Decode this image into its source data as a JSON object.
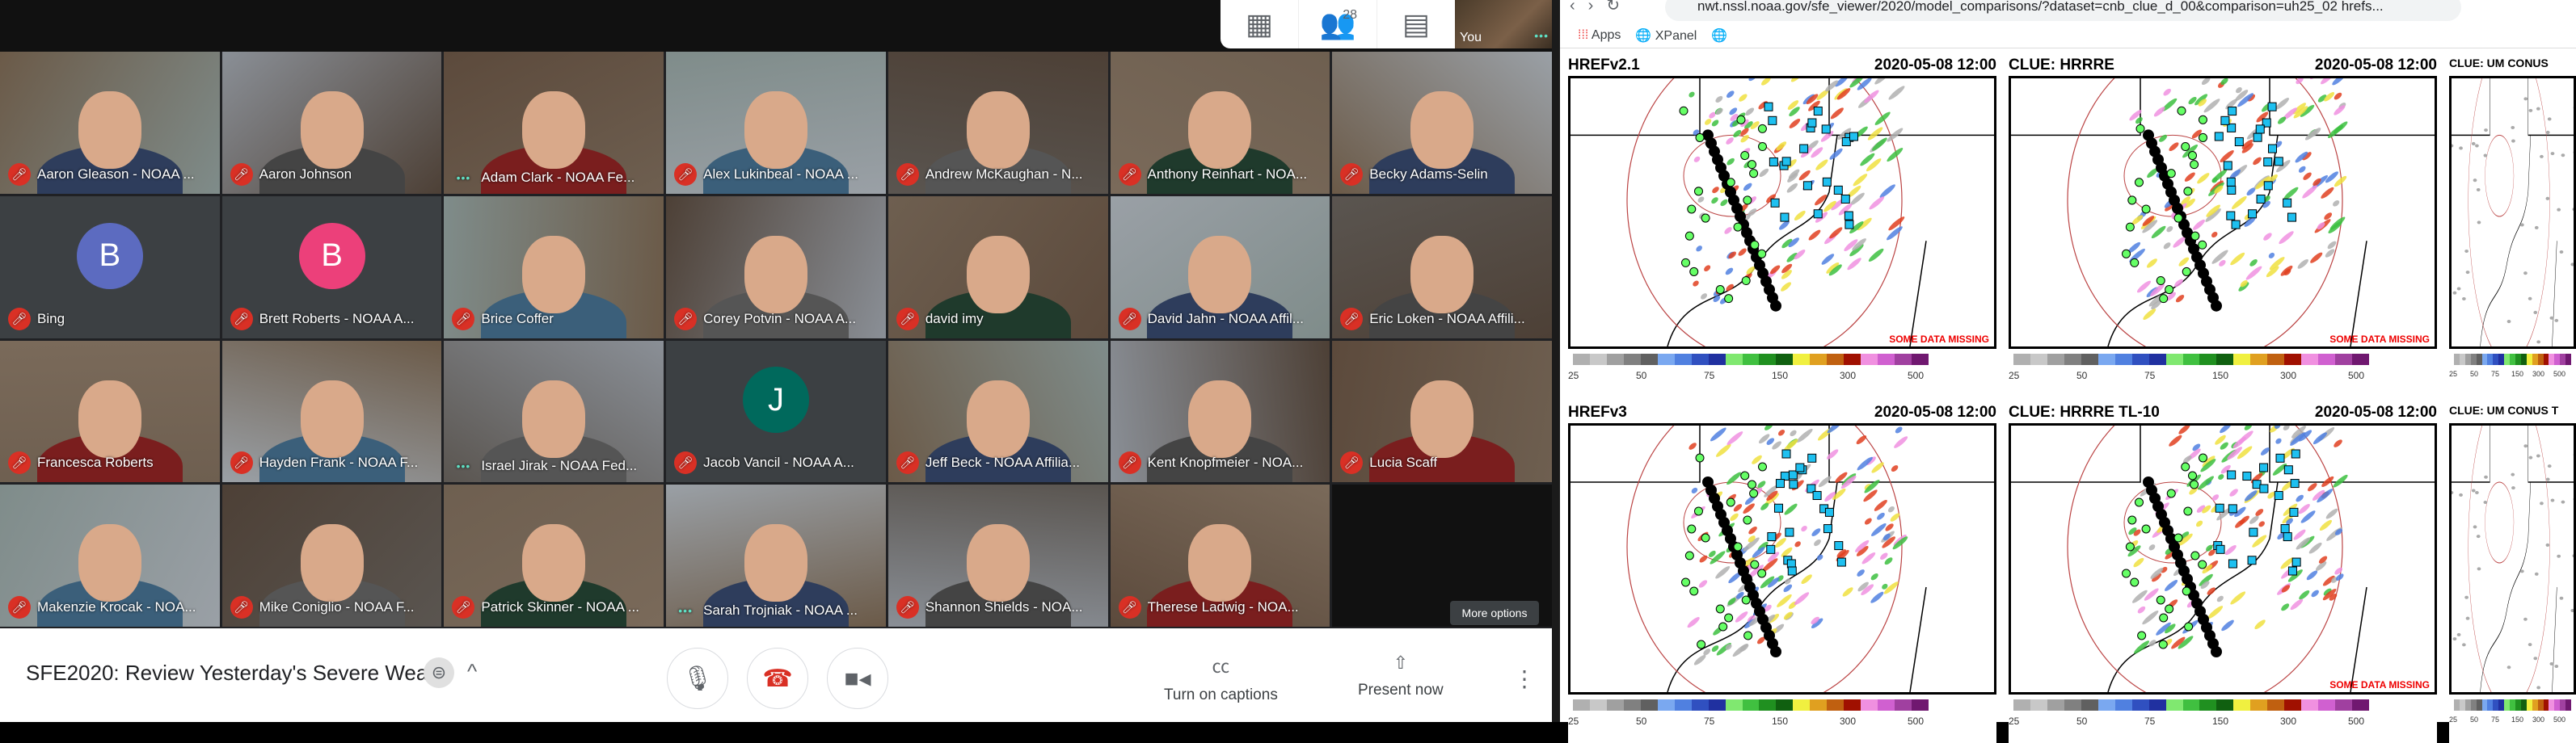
{
  "meet": {
    "controls": {
      "grid_icon": "grid-view-icon",
      "people_count": "28",
      "chat_icon": "chat-icon"
    },
    "self_view": {
      "label": "You"
    },
    "participants": [
      {
        "name": "Aaron Gleason - NOAA ...",
        "state": "muted"
      },
      {
        "name": "Aaron Johnson",
        "state": "muted"
      },
      {
        "name": "Adam Clark - NOAA Fe...",
        "state": "talking"
      },
      {
        "name": "Alex Lukinbeal - NOAA ...",
        "state": "muted"
      },
      {
        "name": "Andrew McKaughan - N...",
        "state": "muted"
      },
      {
        "name": "Anthony Reinhart - NOA...",
        "state": "muted"
      },
      {
        "name": "Becky Adams-Selin",
        "state": "muted"
      },
      {
        "name": "Bing",
        "state": "muted",
        "avatar": "B",
        "avatar_color": "#5c6bc0"
      },
      {
        "name": "Brett Roberts - NOAA A...",
        "state": "muted",
        "avatar": "B",
        "avatar_color": "#ec407a"
      },
      {
        "name": "Brice Coffer",
        "state": "muted"
      },
      {
        "name": "Corey Potvin - NOAA A...",
        "state": "muted"
      },
      {
        "name": "david imy",
        "state": "muted"
      },
      {
        "name": "David Jahn - NOAA Affil...",
        "state": "muted"
      },
      {
        "name": "Eric Loken - NOAA Affili...",
        "state": "muted"
      },
      {
        "name": "Francesca Roberts",
        "state": "muted"
      },
      {
        "name": "Hayden Frank - NOAA F...",
        "state": "muted"
      },
      {
        "name": "Israel Jirak - NOAA Fed...",
        "state": "talking"
      },
      {
        "name": "Jacob Vancil - NOAA A...",
        "state": "muted",
        "avatar": "J",
        "avatar_color": "#00695c"
      },
      {
        "name": "Jeff Beck - NOAA Affilia...",
        "state": "muted"
      },
      {
        "name": "Kent Knopfmeier - NOA...",
        "state": "muted"
      },
      {
        "name": "Lucia Scaff",
        "state": "muted"
      },
      {
        "name": "Makenzie Krocak - NOA...",
        "state": "muted"
      },
      {
        "name": "Mike Coniglio - NOAA F...",
        "state": "muted"
      },
      {
        "name": "Patrick Skinner - NOAA ...",
        "state": "muted"
      },
      {
        "name": "Sarah Trojniak - NOAA ...",
        "state": "talking"
      },
      {
        "name": "Shannon Shields - NOA...",
        "state": "muted"
      },
      {
        "name": "Therese Ladwig - NOA...",
        "state": "muted"
      }
    ],
    "more_options": "More options",
    "bottom": {
      "meeting_title": "SFE2020: Review Yesterday's Severe Weat...",
      "captions": "Turn on captions",
      "present": "Present now"
    },
    "colors": {
      "mute": "#d93025",
      "talking": "#5fe0c4",
      "hangup": "#d93025"
    }
  },
  "browser": {
    "url": "nwt.nssl.noaa.gov/sfe_viewer/2020/model_comparisons/?dataset=cnb_clue_d_00&comparison=uh25_02 hrefs...",
    "bookmarks": [
      "Apps",
      "XPanel"
    ],
    "panels": [
      {
        "model": "HREFv2.1",
        "time": "2020-05-08 12:00",
        "missing": "SOME DATA MISSING"
      },
      {
        "model": "CLUE: HRRRE",
        "time": "2020-05-08 12:00",
        "missing": "SOME DATA MISSING"
      },
      {
        "model": "CLUE: UM CONUS",
        "time": "",
        "missing": ""
      },
      {
        "model": "HREFv3",
        "time": "2020-05-08 12:00",
        "missing": ""
      },
      {
        "model": "CLUE: HRRRE TL-10",
        "time": "2020-05-08 12:00",
        "missing": "SOME DATA MISSING"
      },
      {
        "model": "CLUE: UM CONUS T",
        "time": "",
        "missing": ""
      }
    ],
    "colorbar_ticks": [
      "25",
      "50",
      "75",
      "150",
      "300",
      "500"
    ],
    "colorbar_colors": [
      "#b0b0b0",
      "#c8c8c8",
      "#a0a0a0",
      "#808080",
      "#606060",
      "#7aa8f0",
      "#5080e0",
      "#3050c0",
      "#2030a0",
      "#80e870",
      "#40c040",
      "#209020",
      "#106010",
      "#f0f040",
      "#e0a020",
      "#c06010",
      "#a01000",
      "#f090e0",
      "#d060d0",
      "#a040a0",
      "#701870"
    ]
  }
}
